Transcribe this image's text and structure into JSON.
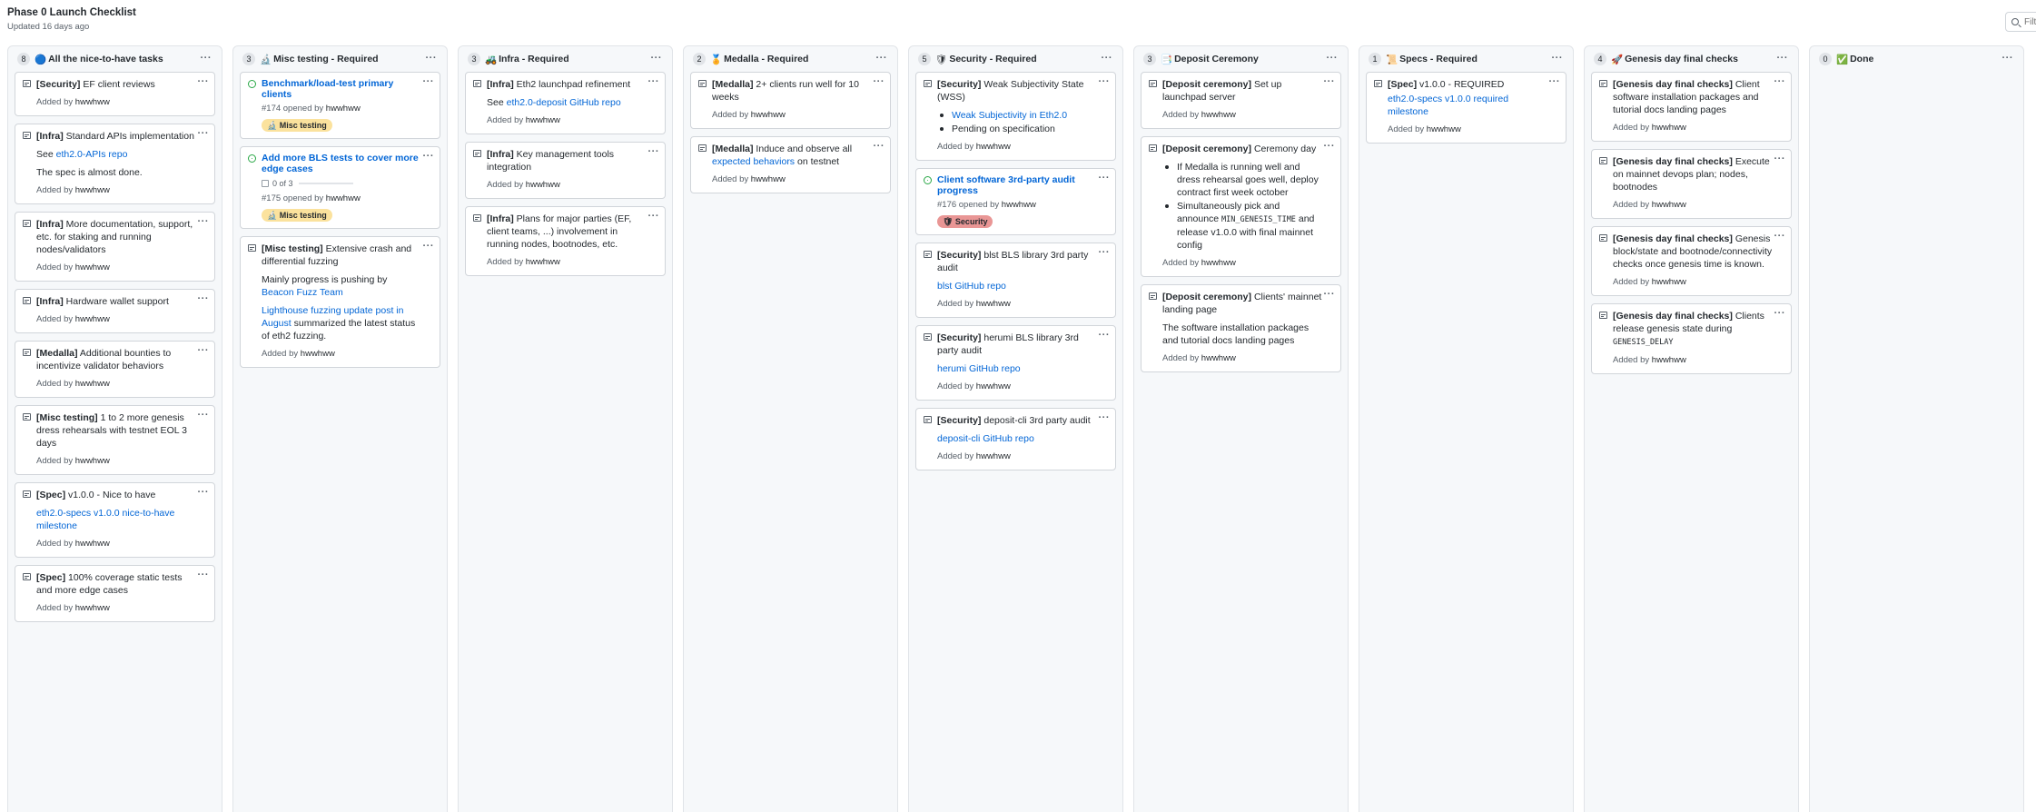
{
  "project": {
    "title": "Phase 0 Launch Checklist",
    "updated": "Updated 16 days ago",
    "filter_placeholder": "Filter"
  },
  "columns": [
    {
      "count": "8",
      "emoji": "🔵",
      "title": "All the nice-to-have tasks",
      "cards": [
        {
          "type": "note",
          "tag": "[Security]",
          "text": " EF client reviews",
          "added": "Added by ",
          "user": "hwwhww"
        },
        {
          "type": "note",
          "tag": "[Infra]",
          "text": " Standard APIs implementation",
          "p1_pre": "See ",
          "p1_link": "eth2.0-APIs repo",
          "p2": "The spec is almost done.",
          "added": "Added by ",
          "user": "hwwhww"
        },
        {
          "type": "note",
          "tag": "[Infra]",
          "text": " More documentation, support, etc. for staking and running nodes/validators",
          "added": "Added by ",
          "user": "hwwhww"
        },
        {
          "type": "note",
          "tag": "[Infra]",
          "text": " Hardware wallet support",
          "added": "Added by ",
          "user": "hwwhww"
        },
        {
          "type": "note",
          "tag": "[Medalla]",
          "text": " Additional bounties to incentivize validator behaviors",
          "added": "Added by ",
          "user": "hwwhww"
        },
        {
          "type": "note",
          "tag": "[Misc testing]",
          "text": " 1 to 2 more genesis dress rehearsals with testnet EOL 3 days",
          "added": "Added by ",
          "user": "hwwhww"
        },
        {
          "type": "note",
          "tag": "[Spec]",
          "text": " v1.0.0 - Nice to have",
          "p1_link": "eth2.0-specs v1.0.0 nice-to-have milestone",
          "added": "Added by ",
          "user": "hwwhww"
        },
        {
          "type": "note",
          "tag": "[Spec]",
          "text": " 100% coverage static tests and more edge cases",
          "added": "Added by ",
          "user": "hwwhww"
        }
      ]
    },
    {
      "count": "3",
      "emoji": "🔬",
      "title": "Misc testing - Required",
      "cards": [
        {
          "type": "issue",
          "title": "Benchmark/load-test primary clients",
          "meta": "#174 opened by ",
          "user": "hwwhww",
          "label": "🔬 Misc testing"
        },
        {
          "type": "issue",
          "title": "Add more BLS tests to cover more edge cases",
          "progress": "0 of 3",
          "meta": "#175 opened by ",
          "user": "hwwhww",
          "label": "🔬 Misc testing"
        },
        {
          "type": "note",
          "tag": "[Misc testing]",
          "text": " Extensive crash and differential fuzzing",
          "p1_pre": "Mainly progress is pushing by ",
          "p1_link": "Beacon Fuzz Team",
          "p2_link": "Lighthouse fuzzing update post in August",
          "p2_post": " summarized the latest status of eth2 fuzzing.",
          "added": "Added by ",
          "user": "hwwhww"
        }
      ]
    },
    {
      "count": "3",
      "emoji": "🚜",
      "title": "Infra - Required",
      "cards": [
        {
          "type": "note",
          "tag": "[Infra]",
          "text": " Eth2 launchpad refinement",
          "p1_pre": "See ",
          "p1_link": "eth2.0-deposit GitHub repo",
          "added": "Added by ",
          "user": "hwwhww"
        },
        {
          "type": "note",
          "tag": "[Infra]",
          "text": " Key management tools integration",
          "added": "Added by ",
          "user": "hwwhww"
        },
        {
          "type": "note",
          "tag": "[Infra]",
          "text": " Plans for major parties (EF, client teams, ...) involvement in running nodes, bootnodes, etc.",
          "added": "Added by ",
          "user": "hwwhww"
        }
      ]
    },
    {
      "count": "2",
      "emoji": "🏅",
      "title": "Medalla - Required",
      "cards": [
        {
          "type": "note",
          "tag": "[Medalla]",
          "text": " 2+ clients run well for 10 weeks",
          "added": "Added by ",
          "user": "hwwhww"
        },
        {
          "type": "note",
          "tag": "[Medalla]",
          "text": " Induce and observe all ",
          "text_link": "expected behaviors",
          "text_post": " on testnet",
          "added": "Added by ",
          "user": "hwwhww"
        }
      ]
    },
    {
      "count": "5",
      "emoji": "🛡",
      "title": "Security - Required",
      "cards": [
        {
          "type": "note",
          "tag": "[Security]",
          "text": " Weak Subjectivity State (WSS)",
          "bullets": [
            {
              "link": "Weak Subjectivity in Eth2.0"
            },
            {
              "text": "Pending on specification"
            }
          ],
          "added": "Added by ",
          "user": "hwwhww"
        },
        {
          "type": "issue",
          "title": "Client software 3rd-party audit progress",
          "meta": "#176 opened by ",
          "user": "hwwhww",
          "label": "🛡 Security"
        },
        {
          "type": "note",
          "tag": "[Security]",
          "text": " blst BLS library 3rd party audit",
          "p1_link": "blst GitHub repo",
          "added": "Added by ",
          "user": "hwwhww"
        },
        {
          "type": "note",
          "tag": "[Security]",
          "text": " herumi BLS library 3rd party audit",
          "p1_link": "herumi GitHub repo",
          "added": "Added by ",
          "user": "hwwhww"
        },
        {
          "type": "note",
          "tag": "[Security]",
          "text": " deposit-cli 3rd party audit",
          "p1_link": "deposit-cli GitHub repo",
          "added": "Added by ",
          "user": "hwwhww"
        }
      ]
    },
    {
      "count": "3",
      "emoji": "📑",
      "title": "Deposit Ceremony",
      "cards": [
        {
          "type": "note",
          "tag": "[Deposit ceremony]",
          "text": " Set up launchpad server",
          "added": "Added by ",
          "user": "hwwhww"
        },
        {
          "type": "note",
          "tag": "[Deposit ceremony]",
          "text": " Ceremony day",
          "bullets": [
            {
              "text": "If Medalla is running well and dress rehearsal goes well, deploy contract first week october"
            },
            {
              "pre": "Simultaneously pick and announce ",
              "code": "MIN_GENESIS_TIME",
              "post": " and release v1.0.0 with final mainnet config"
            }
          ],
          "added": "Added by ",
          "user": "hwwhww"
        },
        {
          "type": "note",
          "tag": "[Deposit ceremony]",
          "text": " Clients' mainnet landing page",
          "p2": "The software installation packages and tutorial docs landing pages",
          "added": "Added by ",
          "user": "hwwhww"
        }
      ]
    },
    {
      "count": "1",
      "emoji": "📜",
      "title": "Specs - Required",
      "cards": [
        {
          "type": "note",
          "tag": "[Spec]",
          "text": " v1.0.0 - REQUIRED",
          "p1_link": "eth2.0-specs v1.0.0 required milestone",
          "tight": true,
          "added": "Added by ",
          "user": "hwwhww"
        }
      ]
    },
    {
      "count": "4",
      "emoji": "🚀",
      "title": "Genesis day final checks",
      "cards": [
        {
          "type": "note",
          "tag": "[Genesis day final checks]",
          "text": " Client software installation packages and tutorial docs landing pages",
          "added": "Added by ",
          "user": "hwwhww"
        },
        {
          "type": "note",
          "tag": "[Genesis day final checks]",
          "text": " Execute on mainnet devops plan; nodes, bootnodes",
          "added": "Added by ",
          "user": "hwwhww"
        },
        {
          "type": "note",
          "tag": "[Genesis day final checks]",
          "text": " Genesis block/state and bootnode/connectivity checks once genesis time is known.",
          "added": "Added by ",
          "user": "hwwhww"
        },
        {
          "type": "note",
          "tag": "[Genesis day final checks]",
          "text": " Clients release genesis state during ",
          "text_code": "GENESIS_DELAY",
          "added": "Added by ",
          "user": "hwwhww"
        }
      ]
    },
    {
      "count": "0",
      "emoji": "✅",
      "title": "Done",
      "cards": []
    }
  ],
  "colors": {
    "link": "#0366d6",
    "misc_label_bg": "#fbe29d",
    "misc_label_fg": "#24292e",
    "security_label_bg": "#e99695",
    "security_label_fg": "#24292e",
    "column_bg": "#f6f8fa",
    "issue_open": "#28a745"
  }
}
